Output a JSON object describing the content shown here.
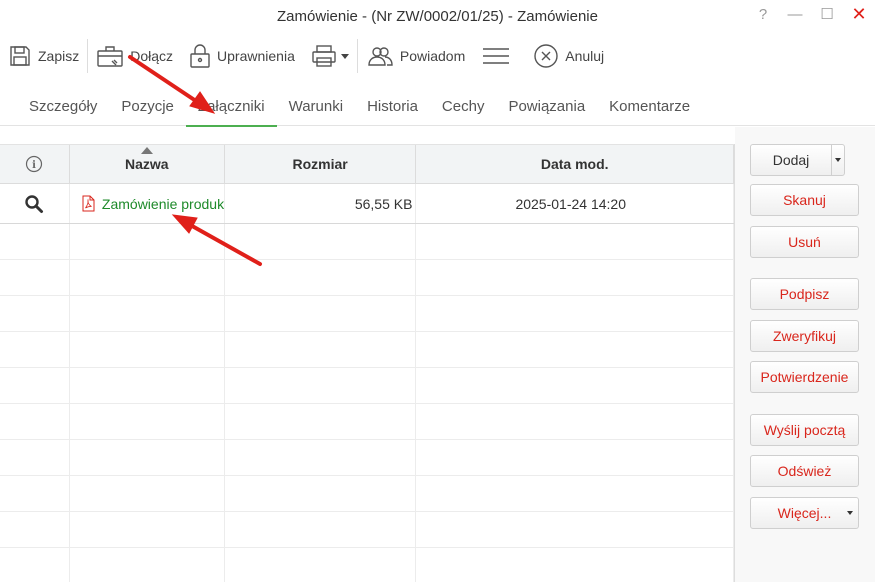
{
  "window": {
    "title": "Zamówienie - (Nr ZW/0002/01/25) - Zamówienie",
    "help": "?",
    "minimize": "—",
    "maximize": "☐",
    "close": "✕"
  },
  "toolbar": {
    "save": "Zapisz",
    "attach": "Dołącz",
    "permissions": "Uprawnienia",
    "notify": "Powiadom",
    "cancel": "Anuluj"
  },
  "tabs": [
    "Szczegóły",
    "Pozycje",
    "Załączniki",
    "Warunki",
    "Historia",
    "Cechy",
    "Powiązania",
    "Komentarze"
  ],
  "active_tab": "Załączniki",
  "grid": {
    "columns": {
      "info": "i",
      "name": "Nazwa",
      "size": "Rozmiar",
      "date": "Data mod."
    },
    "rows": [
      {
        "name": "Zamówienie produk",
        "size": "56,55 KB",
        "date": "2025-01-24 14:20"
      }
    ]
  },
  "side_buttons": {
    "add": "Dodaj",
    "scan": "Skanuj",
    "delete": "Usuń",
    "sign": "Podpisz",
    "verify": "Zweryfikuj",
    "confirmation": "Potwierdzenie",
    "send_mail": "Wyślij pocztą",
    "refresh": "Odśwież",
    "more": "Więcej..."
  },
  "colors": {
    "accent_green": "#4caf50",
    "link_green": "#1e8a2a",
    "action_red": "#d9261c",
    "annotation_red": "#e0201a"
  }
}
